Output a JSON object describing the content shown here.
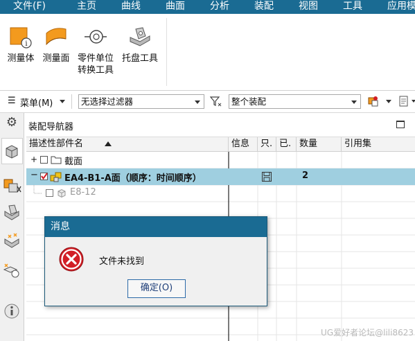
{
  "menu": [
    "文件(F)",
    "主页",
    "曲线",
    "曲面",
    "分析",
    "装配",
    "视图",
    "工具",
    "应用模"
  ],
  "ribbon": {
    "buttons": [
      {
        "label": "测量体",
        "icon": "measure-body-icon"
      },
      {
        "label": "测量面",
        "icon": "measure-face-icon"
      },
      {
        "label_line1": "零件单位",
        "label_line2": "转换工具",
        "icon": "part-unit-convert-icon"
      },
      {
        "label": "托盘工具",
        "icon": "pallet-tool-icon"
      }
    ]
  },
  "selection_bar": {
    "menu_label": "菜单(M)",
    "filter_value": "无选择过滤器",
    "scope_value": "整个装配"
  },
  "navigator": {
    "title": "装配导航器",
    "columns": [
      "描述性部件名",
      "信息",
      "只.",
      "已.",
      "数量",
      "引用集"
    ],
    "rows": [
      {
        "name": "截面",
        "expand": "+",
        "checked": false,
        "selected": false,
        "qty": ""
      },
      {
        "name": "EA4-B1-A面（顺序：时间顺序）",
        "expand": "−",
        "checked": true,
        "selected": true,
        "qty": "2"
      },
      {
        "name": "E8-12",
        "expand": "",
        "checked": false,
        "selected": false,
        "qty": "",
        "dimmed": true
      }
    ],
    "selected_row_color": "#9fcfe0"
  },
  "dialog": {
    "title": "消息",
    "message": "文件未找到",
    "ok_label": "确定(O)",
    "icon": "error-icon"
  },
  "watermark": "UG爱好者论坛@lili8623",
  "colors": {
    "menubar": "#1a6b93",
    "selection": "#9fcfe0",
    "error": "#d21f26"
  }
}
